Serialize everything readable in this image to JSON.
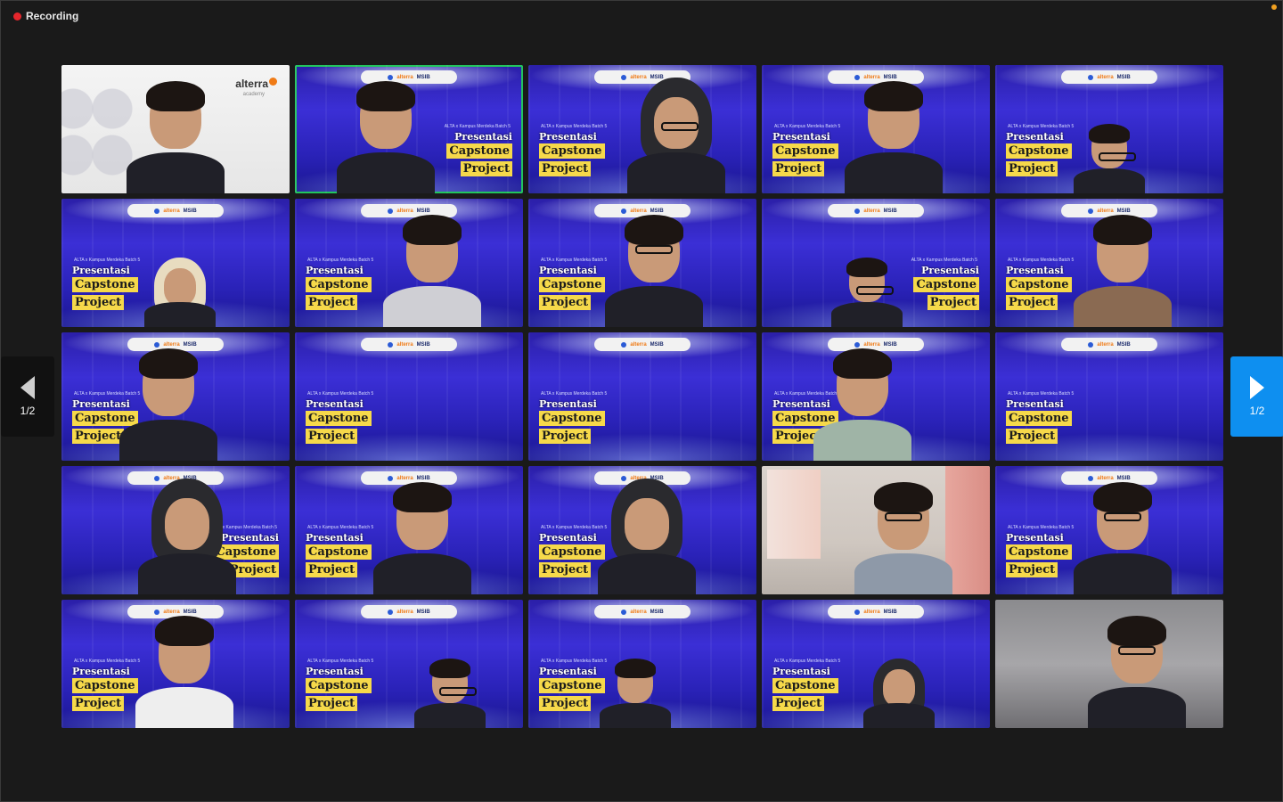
{
  "recording": {
    "label": "Recording"
  },
  "banner": {
    "brand": "alterra",
    "program": "MSIB"
  },
  "overlay": {
    "small_text": "ALTA x Kampus Merdeka Batch 5",
    "presentasi": "Presentasi",
    "capstone": "Capstone",
    "project": "Project"
  },
  "host_tile": {
    "logo_text": "alterra",
    "logo_sub": "academy"
  },
  "pagination": {
    "prev_label": "1/2",
    "next_label": "1/2"
  },
  "colors": {
    "active_speaker_border": "#22c55e",
    "recording_dot": "#e5262c",
    "next_button": "#0e8ff0"
  },
  "icons": {
    "recording": "recording-dot-icon",
    "prev": "triangle-left-icon",
    "next": "triangle-right-icon"
  }
}
